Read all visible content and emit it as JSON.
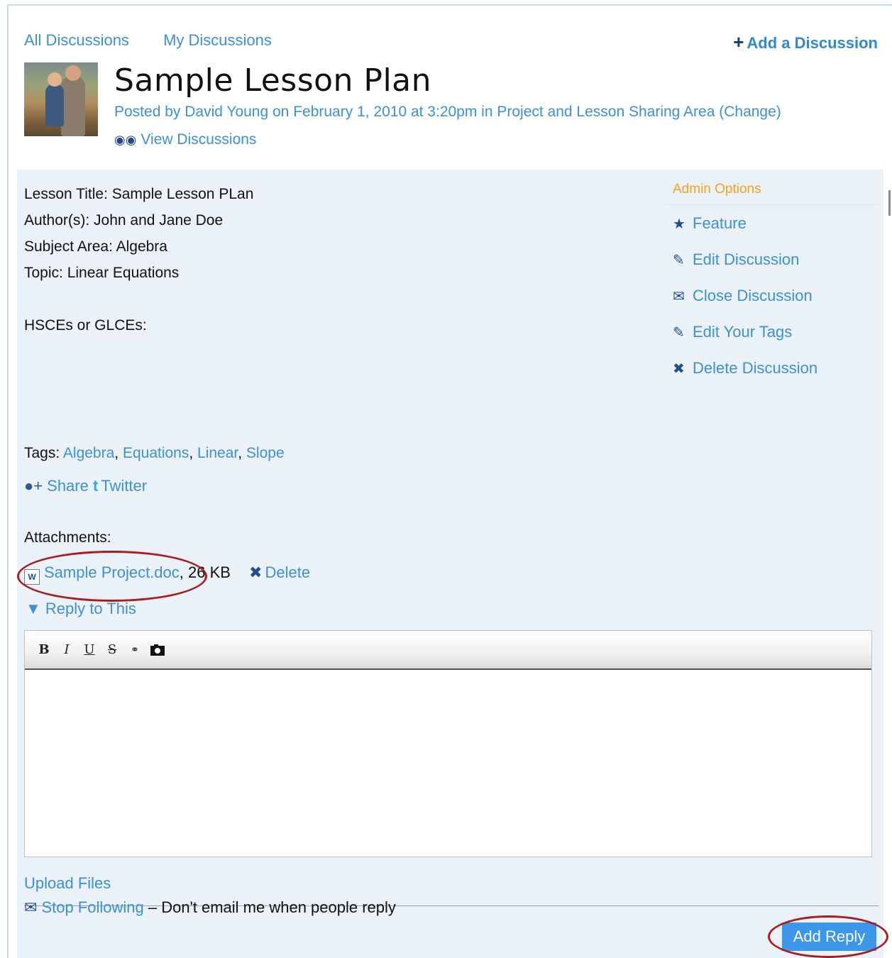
{
  "nav": {
    "all_discussions": "All Discussions",
    "my_discussions": "My Discussions",
    "add_discussion": "Add a Discussion"
  },
  "discussion": {
    "title": "Sample Lesson Plan",
    "posted_by": "Posted by David Young on February 1, 2010 at 3:20pm in Project and Lesson Sharing Area (Change)",
    "view_discussions": "View Discussions"
  },
  "body": {
    "lines": [
      "Lesson Title: Sample Lesson PLan",
      "Author(s): John and Jane Doe",
      "Subject Area: Algebra",
      "Topic: Linear Equations",
      "",
      "HSCEs or GLCEs:"
    ]
  },
  "admin": {
    "title": "Admin Options",
    "items": [
      {
        "label": "Feature",
        "icon": "star-icon"
      },
      {
        "label": "Edit Discussion",
        "icon": "pencil-icon"
      },
      {
        "label": "Close Discussion",
        "icon": "close-discussion-icon"
      },
      {
        "label": "Edit Your Tags",
        "icon": "pencil-icon"
      },
      {
        "label": "Delete Discussion",
        "icon": "x-icon"
      }
    ]
  },
  "tags": {
    "label": "Tags:",
    "items": [
      "Algebra",
      "Equations",
      "Linear",
      "Slope"
    ]
  },
  "social": {
    "share": "Share",
    "twitter": "Twitter"
  },
  "attachments": {
    "label": "Attachments:",
    "file_name": "Sample Project.doc",
    "file_size": ", 26 KB",
    "delete": "Delete"
  },
  "reply": {
    "toggle": "Reply to This",
    "toolbar": [
      "B",
      "I",
      "U",
      "S",
      "link",
      "image"
    ],
    "upload": "Upload Files",
    "stop_following": "Stop Following",
    "follow_note": " – Don't email me when people reply",
    "add_reply": "Add Reply"
  },
  "colors": {
    "link": "#3d8fd6",
    "admin_title": "#f5a21a",
    "panel_bg": "#eaf2f8",
    "button_bg": "#3c97ea",
    "annotation": "#a81d24"
  }
}
